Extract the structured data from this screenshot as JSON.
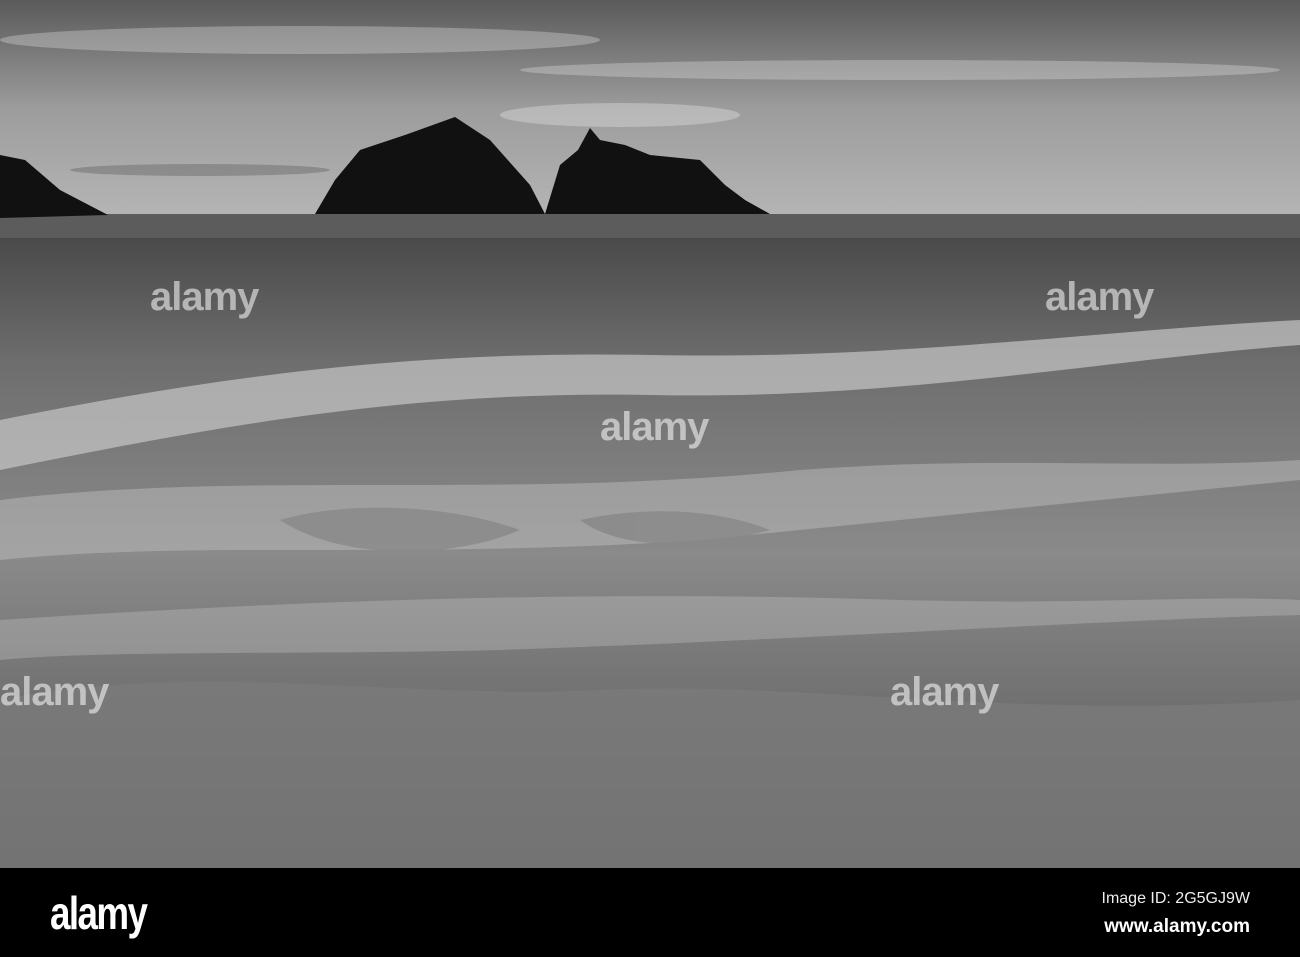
{
  "watermark": {
    "logo": "alamy",
    "image_id": "Image ID: 2G5GJ9W",
    "site": "www.alamy.com"
  },
  "colors": {
    "bar": "#000000",
    "sky": "#9a9a9a",
    "sand": "#6a6a6a",
    "rock": "#111111"
  }
}
